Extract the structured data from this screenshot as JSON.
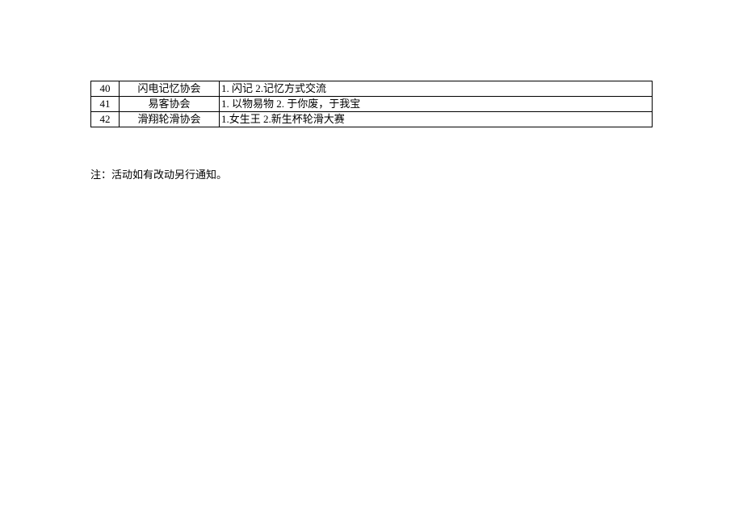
{
  "table": {
    "rows": [
      {
        "num": "40",
        "name": "闪电记忆协会",
        "desc": "1. 闪记 2.记忆方式交流"
      },
      {
        "num": "41",
        "name": "易客协会",
        "desc": "1. 以物易物 2. 于你废，于我宝"
      },
      {
        "num": "42",
        "name": "滑翔轮滑协会",
        "desc": "1.女生王 2.新生杯轮滑大赛"
      }
    ]
  },
  "note": "注：活动如有改动另行通知。"
}
